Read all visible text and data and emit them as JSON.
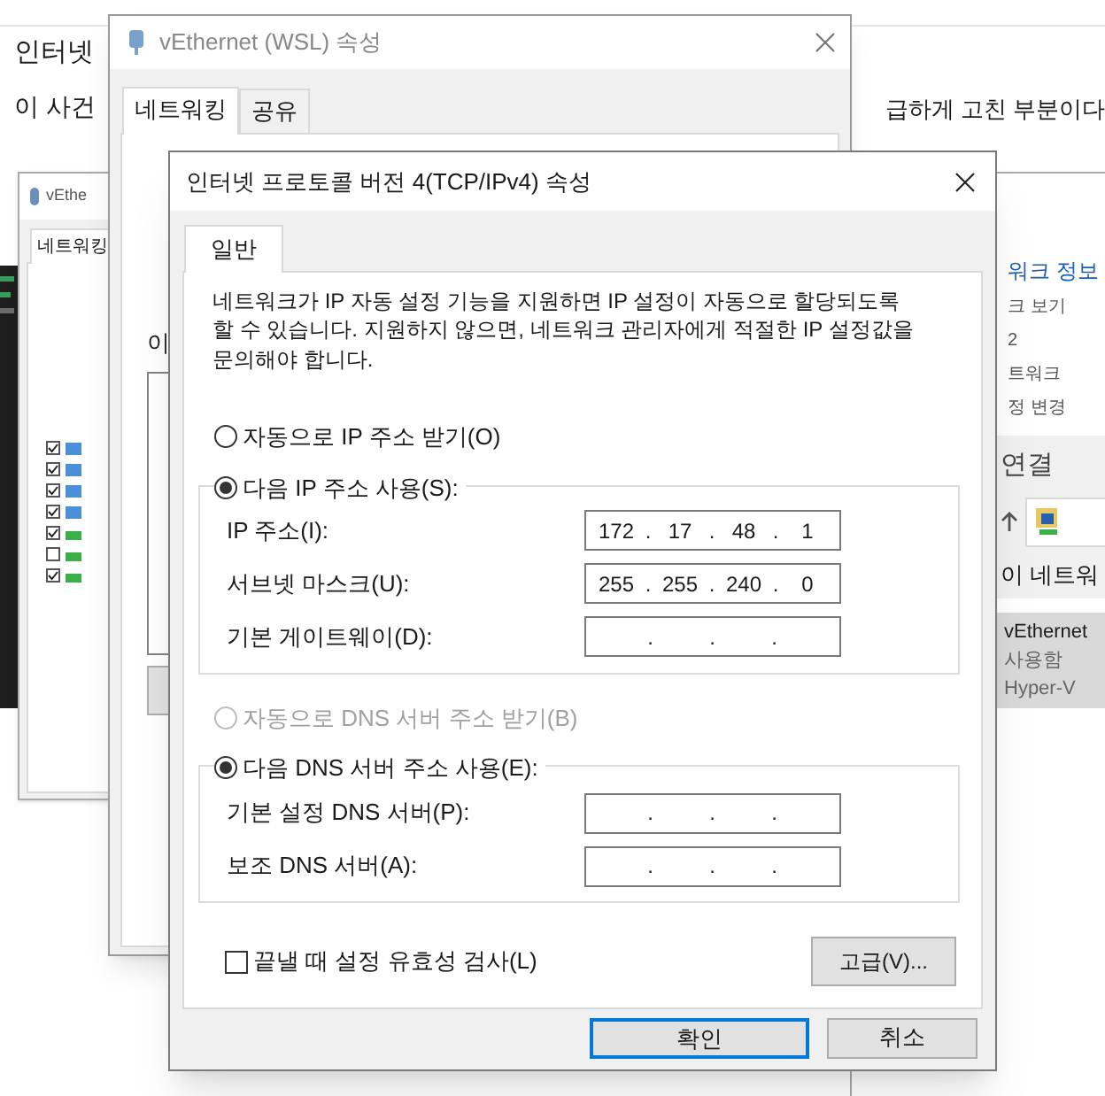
{
  "page": {
    "heading": "인터넷",
    "line_start": "이 사건",
    "line_end": "급하게 고친 부분이다"
  },
  "left_window": {
    "title": "vEthe",
    "tabs": [
      {
        "label": "네트워킹",
        "selected": true
      }
    ],
    "items": [
      {
        "checked": true
      },
      {
        "checked": true
      },
      {
        "checked": true
      },
      {
        "checked": true
      },
      {
        "checked": true
      },
      {
        "checked": false
      },
      {
        "checked": true
      }
    ]
  },
  "properties_window": {
    "title": "vEthernet (WSL) 속성",
    "tabs": [
      {
        "label": "네트워킹",
        "selected": true
      },
      {
        "label": "공유",
        "selected": false
      }
    ],
    "label_fragment": "이"
  },
  "explorer_window": {
    "link": "워크 정보",
    "texts": [
      "크 보기",
      "2",
      "트워크",
      "정 변경"
    ],
    "section": "연결",
    "list_header": "이 네트워",
    "item": {
      "name": "vEthernet",
      "status": "사용함",
      "device": "Hyper-V",
      "selected": true
    }
  },
  "dialog": {
    "title": "인터넷 프로토콜 버전 4(TCP/IPv4) 속성",
    "tabs": [
      {
        "label": "일반",
        "selected": true
      }
    ],
    "description": "네트워크가 IP 자동 설정 기능을 지원하면 IP 설정이 자동으로 할당되도록 할 수 있습니다. 지원하지 않으면, 네트워크 관리자에게 적절한 IP 설정값을 문의해야 합니다.",
    "ip_auto": {
      "label": "자동으로 IP 주소 받기(O)",
      "selected": false,
      "disabled": false
    },
    "ip_manual": {
      "label": "다음 IP 주소 사용(S):",
      "selected": true,
      "disabled": false
    },
    "ip_fields": [
      {
        "label": "IP 주소(I):",
        "segments": [
          "172",
          ".",
          "17",
          ".",
          "48",
          ".",
          "1"
        ]
      },
      {
        "label": "서브넷 마스크(U):",
        "segments": [
          "255",
          ".",
          "255",
          ".",
          "240",
          ".",
          "0"
        ]
      },
      {
        "label": "기본 게이트웨이(D):",
        "segments": [
          ".",
          ".",
          "."
        ]
      }
    ],
    "dns_auto": {
      "label": "자동으로 DNS 서버 주소 받기(B)",
      "selected": false,
      "disabled": true
    },
    "dns_manual": {
      "label": "다음 DNS 서버 주소 사용(E):",
      "selected": true,
      "disabled": false
    },
    "dns_fields": [
      {
        "label": "기본 설정 DNS 서버(P):",
        "segments": [
          ".",
          ".",
          "."
        ]
      },
      {
        "label": "보조 DNS 서버(A):",
        "segments": [
          ".",
          ".",
          "."
        ]
      }
    ],
    "validate": {
      "label": "끝낼 때 설정 유효성 검사(L)",
      "checked": false
    },
    "advanced_button": "고급(V)...",
    "buttons": [
      {
        "label": "확인",
        "default": true
      },
      {
        "label": "취소",
        "default": false
      }
    ]
  }
}
